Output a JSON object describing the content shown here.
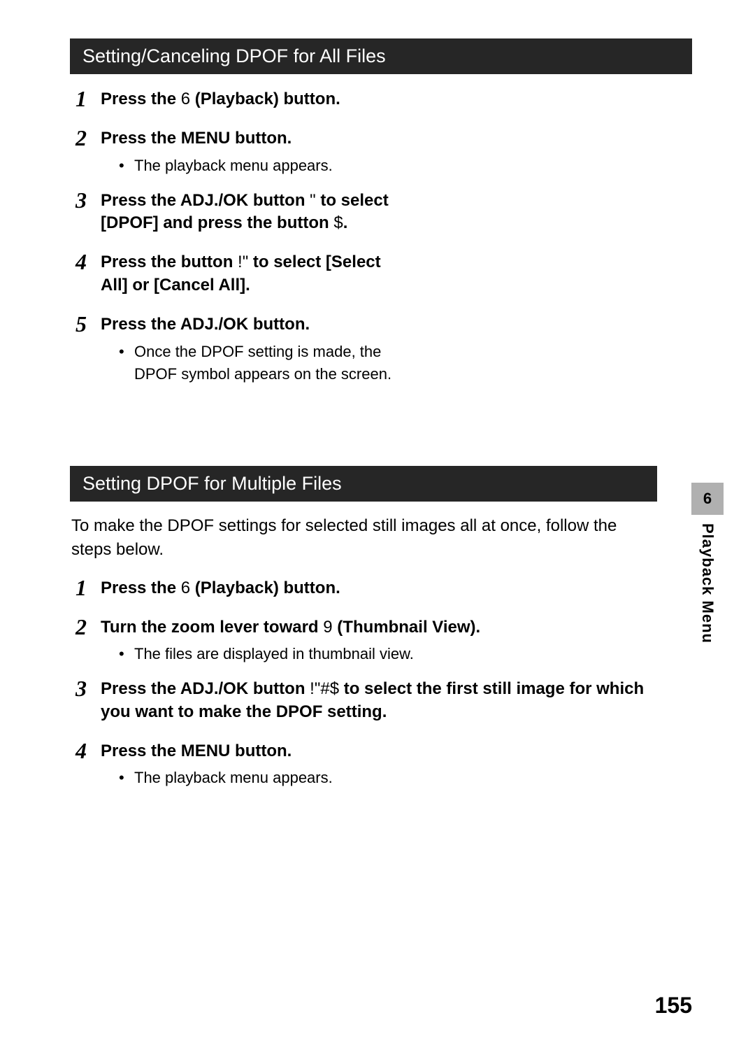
{
  "section1": {
    "header": "Setting/Canceling DPOF for All Files",
    "steps": [
      {
        "num": "1",
        "title_parts": [
          "Press the ",
          "6",
          " (Playback) button."
        ],
        "sub": []
      },
      {
        "num": "2",
        "title_parts": [
          "Press the MENU button."
        ],
        "sub": [
          "The playback menu appears."
        ]
      },
      {
        "num": "3",
        "title_parts": [
          "Press the ADJ./OK button ",
          "\"",
          " to select [DPOF] and press the button ",
          "$",
          "."
        ],
        "sub": []
      },
      {
        "num": "4",
        "title_parts": [
          "Press the button ",
          "!\"",
          " to select [Select All] or [Cancel All]."
        ],
        "sub": []
      },
      {
        "num": "5",
        "title_parts": [
          "Press the ADJ./OK button."
        ],
        "sub": [
          "Once the DPOF setting is made, the DPOF symbol appears on the screen."
        ]
      }
    ]
  },
  "section2": {
    "header": "Setting DPOF for Multiple Files",
    "intro": "To make the DPOF settings for selected still images all at once, follow the steps below.",
    "steps": [
      {
        "num": "1",
        "title_parts": [
          "Press the ",
          "6",
          " (Playback) button."
        ],
        "sub": []
      },
      {
        "num": "2",
        "title_parts": [
          "Turn the zoom lever toward ",
          "9",
          " (Thumbnail View)."
        ],
        "sub": [
          "The files are displayed in thumbnail view."
        ]
      },
      {
        "num": "3",
        "title_parts": [
          "Press the ADJ./OK button ",
          "!\"#$",
          " to select the first still image for which you want to make the DPOF setting."
        ],
        "sub": []
      },
      {
        "num": "4",
        "title_parts": [
          "Press the MENU button."
        ],
        "sub": [
          "The playback menu appears."
        ]
      }
    ]
  },
  "sidebar": {
    "chapter_num": "6",
    "chapter_label": "Playback Menu"
  },
  "page_number": "155"
}
